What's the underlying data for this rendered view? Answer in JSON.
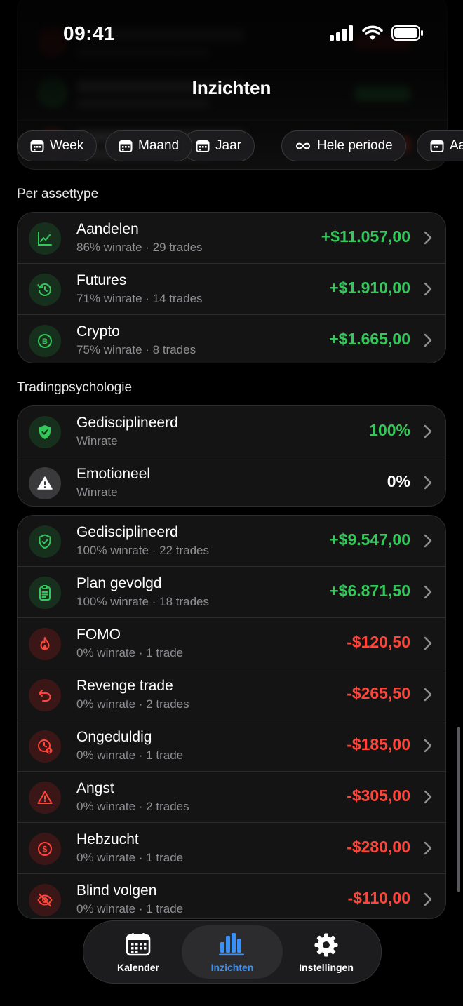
{
  "status_bar": {
    "time": "09:41"
  },
  "header": {
    "title": "Inzichten"
  },
  "periods": [
    {
      "label": "Week",
      "icon": "calendar-icon",
      "active": false
    },
    {
      "label": "Maand",
      "icon": "calendar-icon",
      "active": true
    },
    {
      "label": "Jaar",
      "icon": "calendar-icon",
      "active": false
    },
    {
      "label": "Hele periode",
      "icon": "infinity-icon",
      "active": false
    },
    {
      "label": "Aa",
      "icon": "calendar-icon",
      "active": false
    }
  ],
  "asset_section": {
    "label": "Per assettype",
    "rows": [
      {
        "title": "Aandelen",
        "subtitle": "86% winrate · 29 trades",
        "value": "+$11.057,00",
        "icon": "chart-icon",
        "tone": "pos"
      },
      {
        "title": "Futures",
        "subtitle": "71% winrate · 14 trades",
        "value": "+$1.910,00",
        "icon": "history-icon",
        "tone": "pos"
      },
      {
        "title": "Crypto",
        "subtitle": "75% winrate · 8 trades",
        "value": "+$1.665,00",
        "icon": "bitcoin-icon",
        "tone": "pos"
      }
    ]
  },
  "psych_section": {
    "label": "Tradingpsychologie",
    "summary_rows": [
      {
        "title": "Gedisciplineerd",
        "subtitle": "Winrate",
        "value": "100%",
        "icon": "shield-check-icon",
        "tone": "pos"
      },
      {
        "title": "Emotioneel",
        "subtitle": "Winrate",
        "value": "0%",
        "icon": "warning-icon",
        "tone": "neu"
      }
    ],
    "detail_rows": [
      {
        "title": "Gedisciplineerd",
        "subtitle": "100% winrate · 22 trades",
        "value": "+$9.547,00",
        "icon": "shield-check-icon",
        "tone": "pos"
      },
      {
        "title": "Plan gevolgd",
        "subtitle": "100% winrate · 18 trades",
        "value": "+$6.871,50",
        "icon": "clipboard-icon",
        "tone": "pos"
      },
      {
        "title": "FOMO",
        "subtitle": "0% winrate · 1 trade",
        "value": "-$120,50",
        "icon": "flame-icon",
        "tone": "neg"
      },
      {
        "title": "Revenge trade",
        "subtitle": "0% winrate · 2 trades",
        "value": "-$265,50",
        "icon": "undo-arrow-icon",
        "tone": "neg"
      },
      {
        "title": "Ongeduldig",
        "subtitle": "0% winrate · 1 trade",
        "value": "-$185,00",
        "icon": "clock-alert-icon",
        "tone": "neg"
      },
      {
        "title": "Angst",
        "subtitle": "0% winrate · 2 trades",
        "value": "-$305,00",
        "icon": "warning-icon",
        "tone": "neg"
      },
      {
        "title": "Hebzucht",
        "subtitle": "0% winrate · 1 trade",
        "value": "-$280,00",
        "icon": "dollar-icon",
        "tone": "neg"
      },
      {
        "title": "Blind volgen",
        "subtitle": "0% winrate · 1 trade",
        "value": "-$110,00",
        "icon": "eye-off-icon",
        "tone": "neg"
      }
    ]
  },
  "tabbar": [
    {
      "label": "Kalender",
      "icon": "calendar-grid-icon",
      "active": false
    },
    {
      "label": "Inzichten",
      "icon": "bar-chart-icon",
      "active": true
    },
    {
      "label": "Instellingen",
      "icon": "gear-icon",
      "active": false
    }
  ],
  "colors": {
    "positive": "#34c759",
    "negative": "#ff453a",
    "accent": "#2f8cf3"
  }
}
